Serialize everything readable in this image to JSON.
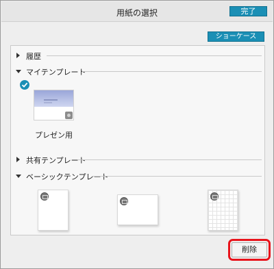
{
  "window": {
    "title": "用紙の選択"
  },
  "toolbar": {
    "done_label": "完了",
    "showcase_label": "ショーケース"
  },
  "sections": {
    "history": {
      "label": "履歴",
      "expanded": false
    },
    "my_templates": {
      "label": "マイテンプレート",
      "expanded": true
    },
    "shared_templates": {
      "label": "共有テンプレート",
      "expanded": false
    },
    "basic_templates": {
      "label": "ベーシックテンプレート",
      "expanded": true
    }
  },
  "my_templates": {
    "items": [
      {
        "label": "プレゼン用",
        "selected": true
      }
    ]
  },
  "basic_templates": {
    "items": [
      {
        "kind": "portrait-blank"
      },
      {
        "kind": "landscape-blank"
      },
      {
        "kind": "portrait-grid"
      }
    ]
  },
  "footer": {
    "delete_label": "削除"
  },
  "colors": {
    "accent": "#1b8fb5",
    "highlight": "#e8131b"
  }
}
